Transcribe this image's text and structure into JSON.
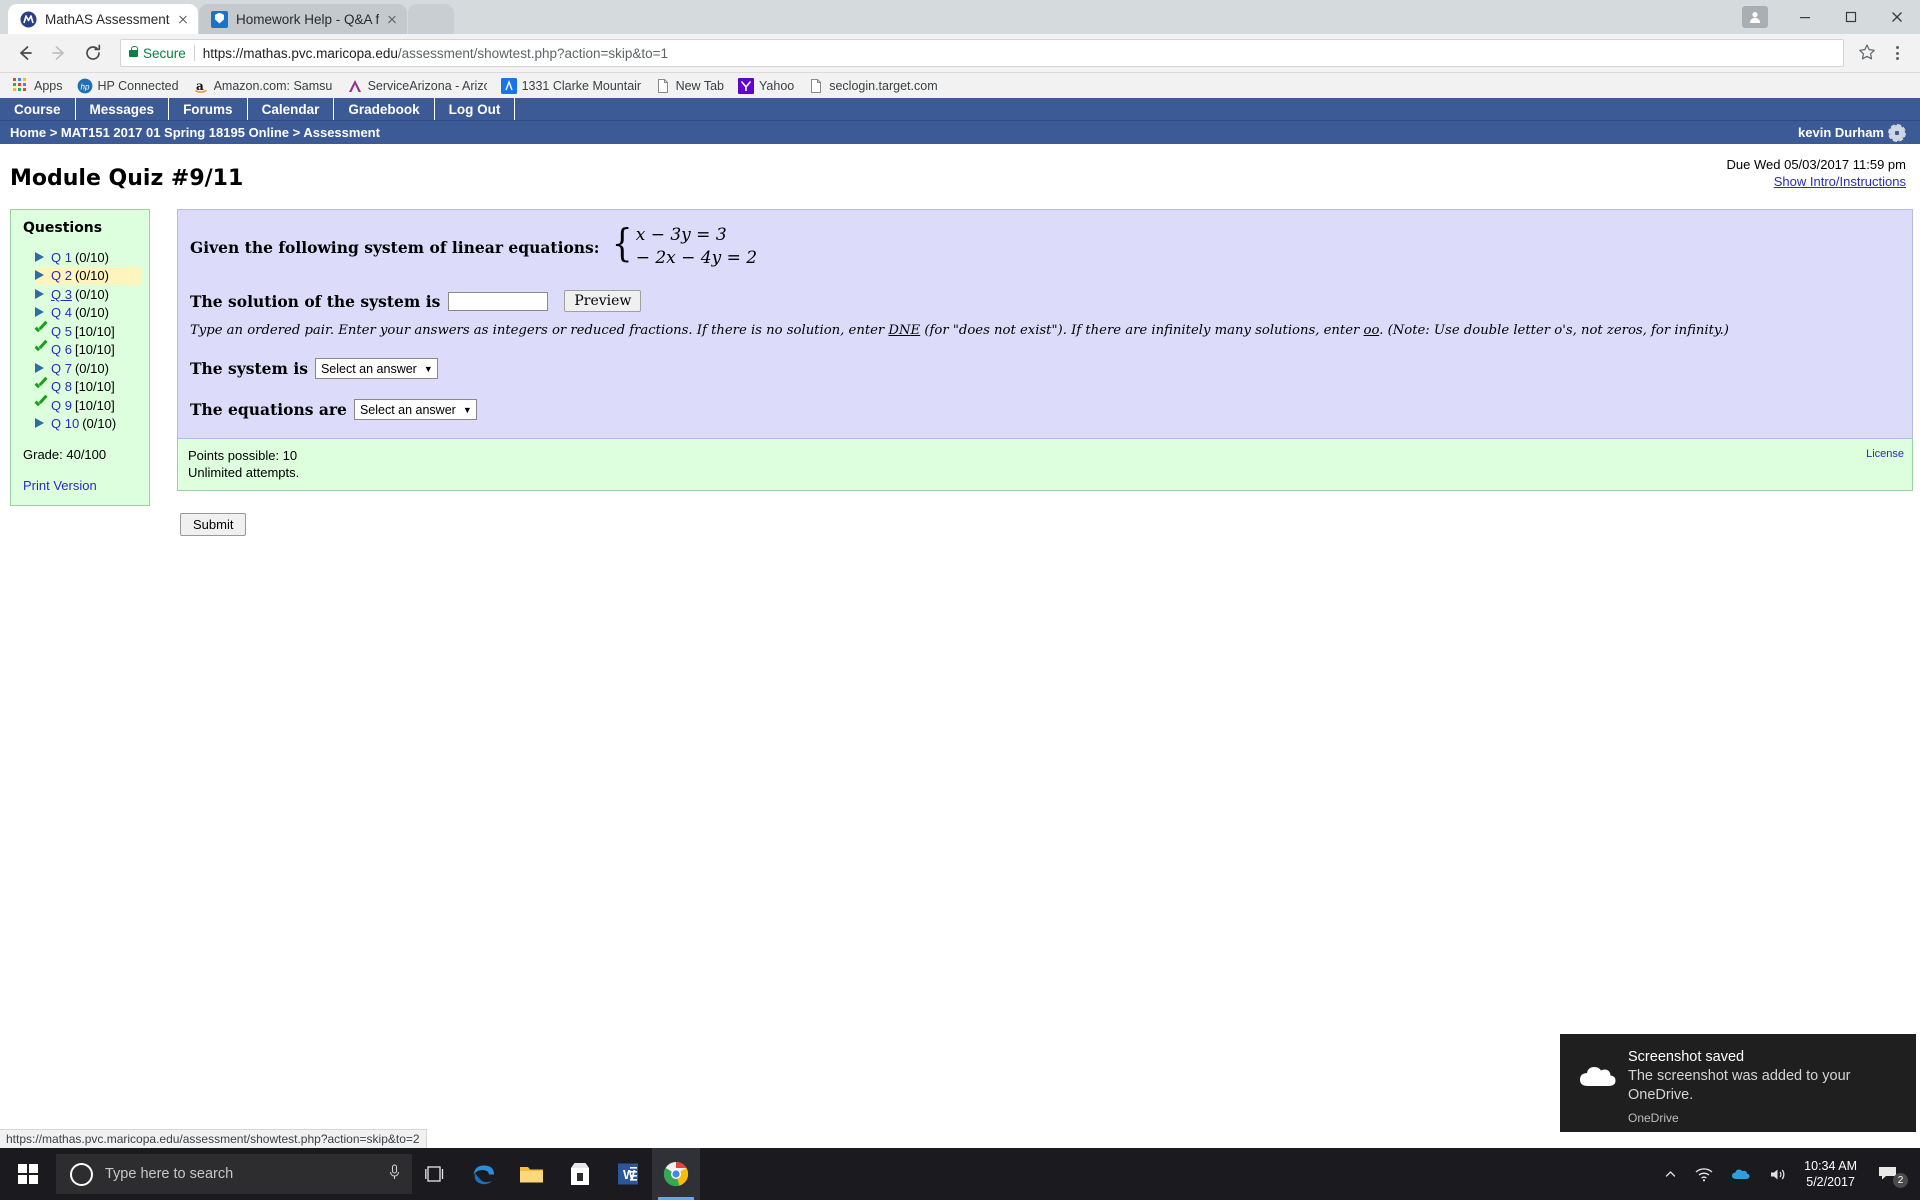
{
  "browser": {
    "tabs": [
      {
        "title": "MathAS Assessment",
        "favicon": "mathas-icon",
        "active": true
      },
      {
        "title": "Homework Help - Q&A f",
        "favicon": "shield-icon",
        "active": false
      }
    ],
    "omnibox": {
      "secure_label": "Secure",
      "url_host": "https://mathas.pvc.maricopa.edu",
      "url_path": "/assessment/showtest.php?action=skip&to=1"
    },
    "bookmarks": [
      {
        "label": "Apps",
        "icon": "apps-grid-icon"
      },
      {
        "label": "HP Connected",
        "icon": "hp-icon"
      },
      {
        "label": "Amazon.com: Samsun",
        "icon": "amazon-icon"
      },
      {
        "label": "ServiceArizona - Arizo",
        "icon": "servicearizona-icon"
      },
      {
        "label": "1331 Clarke Mountain",
        "icon": "maps-icon"
      },
      {
        "label": "New Tab",
        "icon": "page-icon"
      },
      {
        "label": "Yahoo",
        "icon": "yahoo-icon"
      },
      {
        "label": "seclogin.target.com",
        "icon": "page-icon"
      }
    ],
    "status_url": "https://mathas.pvc.maricopa.edu/assessment/showtest.php?action=skip&to=2"
  },
  "site": {
    "nav": [
      {
        "label": "Course"
      },
      {
        "label": "Messages"
      },
      {
        "label": "Forums"
      },
      {
        "label": "Calendar"
      },
      {
        "label": "Gradebook"
      },
      {
        "label": "Log Out"
      }
    ],
    "breadcrumb": "Home > MAT151 2017 01 Spring 18195 Online > Assessment",
    "user": "kevin Durham"
  },
  "quiz": {
    "title": "Module Quiz #9/11",
    "due": "Due Wed 05/03/2017 11:59 pm",
    "show_intro": "Show Intro/Instructions"
  },
  "questions_panel": {
    "heading": "Questions",
    "items": [
      {
        "label": "Q 1",
        "score": "(0/10)",
        "state": "unanswered"
      },
      {
        "label": "Q 2",
        "score": "(0/10)",
        "state": "current"
      },
      {
        "label": "Q 3",
        "score": "(0/10)",
        "state": "hovered"
      },
      {
        "label": "Q 4",
        "score": "(0/10)",
        "state": "unanswered"
      },
      {
        "label": "Q 5",
        "score": "[10/10]",
        "state": "correct"
      },
      {
        "label": "Q 6",
        "score": "[10/10]",
        "state": "correct"
      },
      {
        "label": "Q 7",
        "score": "(0/10)",
        "state": "unanswered"
      },
      {
        "label": "Q 8",
        "score": "[10/10]",
        "state": "correct"
      },
      {
        "label": "Q 9",
        "score": "[10/10]",
        "state": "correct"
      },
      {
        "label": "Q 10",
        "score": "(0/10)",
        "state": "unanswered"
      }
    ],
    "grade": "Grade: 40/100",
    "print_version": "Print Version"
  },
  "question": {
    "prompt": "Given the following system of linear equations:",
    "equation_1": "x − 3y = 3",
    "equation_2": "− 2x − 4y = 2",
    "solution_label": "The solution of the system is",
    "solution_value": "",
    "preview_label": "Preview",
    "hint": "Type an ordered pair. Enter your answers as integers or reduced fractions. If there is no solution, enter DNE (for \"does not exist\"). If there are infinitely many solutions, enter oo. (Note: Use double letter o's, not zeros, for infinity.)",
    "hint_part_1": "Type an ordered pair. Enter your answers as integers or reduced fractions. If there is no solution, enter ",
    "hint_dne": "DNE",
    "hint_part_2": " (for \"does not exist\"). If there are infinitely many solutions, enter ",
    "hint_oo": "oo",
    "hint_part_3": ". (Note: Use double letter o's, not zeros, for infinity.)",
    "system_is_label": "The system is",
    "system_is_value": "Select an answer",
    "equations_are_label": "The equations are",
    "equations_are_value": "Select an answer",
    "points_possible": "Points possible: 10",
    "attempts": "Unlimited attempts.",
    "license": "License",
    "submit_label": "Submit"
  },
  "toast": {
    "title": "Screenshot saved",
    "body": "The screenshot was added to your OneDrive.",
    "app": "OneDrive",
    "icon": "cloud-icon"
  },
  "taskbar": {
    "search_placeholder": "Type here to search",
    "time": "10:34 AM",
    "date": "5/2/2017",
    "notification_count": "2",
    "apps": [
      {
        "name": "task-view-icon"
      },
      {
        "name": "edge-icon"
      },
      {
        "name": "file-explorer-icon"
      },
      {
        "name": "microsoft-store-icon"
      },
      {
        "name": "word-icon"
      },
      {
        "name": "chrome-icon"
      }
    ]
  },
  "colors": {
    "nav_blue": "#3c5a96",
    "question_bg": "#dcdcfa",
    "points_bg": "#ddffdd",
    "link": "#2b2bbf",
    "highlight": "#fdf5bd",
    "check_green": "#18a018"
  }
}
